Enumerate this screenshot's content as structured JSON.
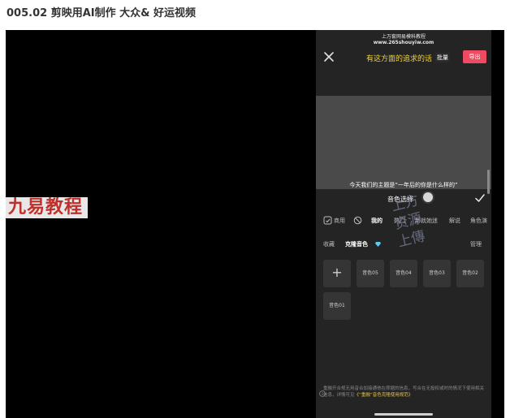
{
  "page": {
    "title": "005.02 剪映用AI制作 大众& 好运视频"
  },
  "video": {
    "brand_logo": "九易教程",
    "seal_watermark": [
      "上方",
      "资源",
      "上傳"
    ]
  },
  "app": {
    "watermark_line1": "上万套网易模科教程",
    "watermark_line2": "www.265shouyiw.com",
    "topic_text": "有这方面的追求的话",
    "batch_label": "批量",
    "export_label": "导出",
    "subtitle": "今天我们的主题是“一年后的你是什么样的”",
    "panel_title": "音色选择",
    "tabs": [
      {
        "label": "商用"
      },
      {
        "label": "我的"
      },
      {
        "label": "热门"
      },
      {
        "label": "新就她迷"
      },
      {
        "label": "解说"
      },
      {
        "label": "角色演"
      }
    ],
    "section": {
      "favorites": "收藏",
      "clone_voice": "克隆音色",
      "manage": "管理"
    },
    "voice_tiles": [
      "音色05",
      "音色04",
      "音色03",
      "音色02",
      "音色01"
    ],
    "add_tile_symbol": "+",
    "footer_note_main": "重融开合规无用音合加接通他在撑据的信息，写合在无投权或时的情况下使用相关信息，详情可见",
    "footer_note_link": "《“重融”音色克隆使用规范》"
  },
  "colors": {
    "accent_yellow": "#f2d233",
    "export_pink": "#f04a63",
    "logo_red": "#c0302a",
    "seal_blue": "#9aa3c2"
  }
}
